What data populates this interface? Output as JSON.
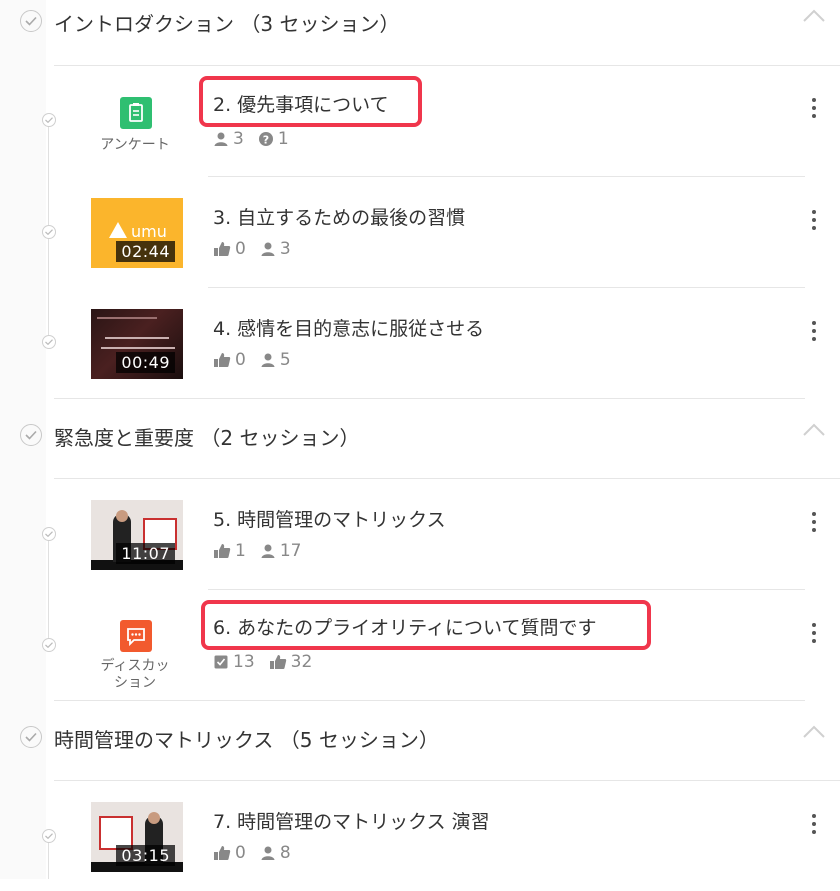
{
  "sections": [
    {
      "title": "イントロダクション （3 セッション）"
    },
    {
      "title": "緊急度と重要度 （2 セッション）"
    },
    {
      "title": "時間管理のマトリックス （5 セッション）"
    }
  ],
  "items": [
    {
      "title": "2. 優先事項について",
      "type_label": "アンケート",
      "stat1": "3",
      "stat2": "1",
      "highlighted": true
    },
    {
      "title": "3. 自立するための最後の習慣",
      "duration": "02:44",
      "thumb_brand": "umu",
      "likes": "0",
      "users": "3"
    },
    {
      "title": "4. 感情を目的意志に服従させる",
      "duration": "00:49",
      "likes": "0",
      "users": "5"
    },
    {
      "title": "5. 時間管理のマトリックス",
      "duration": "11:07",
      "likes": "1",
      "users": "17"
    },
    {
      "title": "6. あなたのプライオリティについて質問です",
      "type_label_1": "ディスカッ",
      "type_label_2": "ション",
      "stat1": "13",
      "stat2": "32",
      "highlighted": true
    },
    {
      "title": "7. 時間管理のマトリックス 演習",
      "duration": "03:15",
      "likes": "0",
      "users": "8"
    }
  ],
  "colors": {
    "survey": "#2fbf71",
    "discussion": "#f25a2e",
    "highlight": "#f0364c",
    "umu_bg": "#fbb52c"
  },
  "icons": [
    "check-icon",
    "chevron-up-icon",
    "kebab-icon",
    "user-icon",
    "question-icon",
    "thumbs-up-icon",
    "checkbox-icon",
    "survey-icon",
    "discussion-icon"
  ]
}
